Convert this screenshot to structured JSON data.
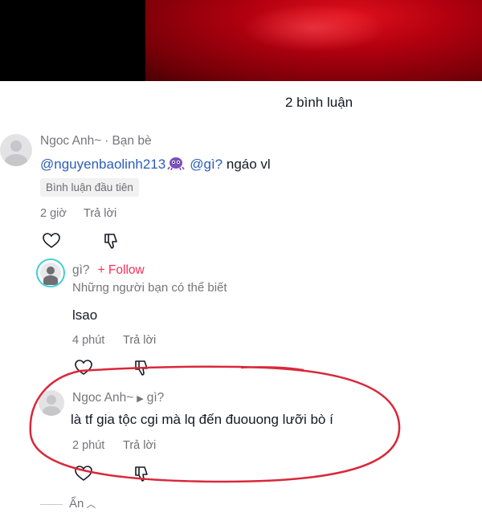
{
  "comments_count": "2 bình luận",
  "comment1": {
    "author": "Ngoc Anh~",
    "relation": "Bạn bè",
    "mention1": "@nguyenbaolinh213",
    "mention2": "@gì?",
    "body": "ngáo vl",
    "badge": "Bình luận đầu tiên",
    "time": "2 giờ",
    "reply_label": "Trả lời"
  },
  "reply1": {
    "author": "gì?",
    "follow_label": "+ Follow",
    "subtitle": "Những người bạn có thể biết",
    "body": "lsao",
    "time": "4 phút",
    "reply_label": "Trả lời"
  },
  "reply2": {
    "author": "Ngoc Anh~",
    "reply_to": "gì?",
    "body": "là tf gia tộc cgi mà lq đến đuouong lưỡi bò í",
    "time": "2 phút",
    "reply_label": "Trả lời"
  },
  "hide_label": "Ẩn",
  "colors": {
    "accent": "#fe2c55",
    "mention": "#2b5db9",
    "annotation": "#d9283a"
  }
}
